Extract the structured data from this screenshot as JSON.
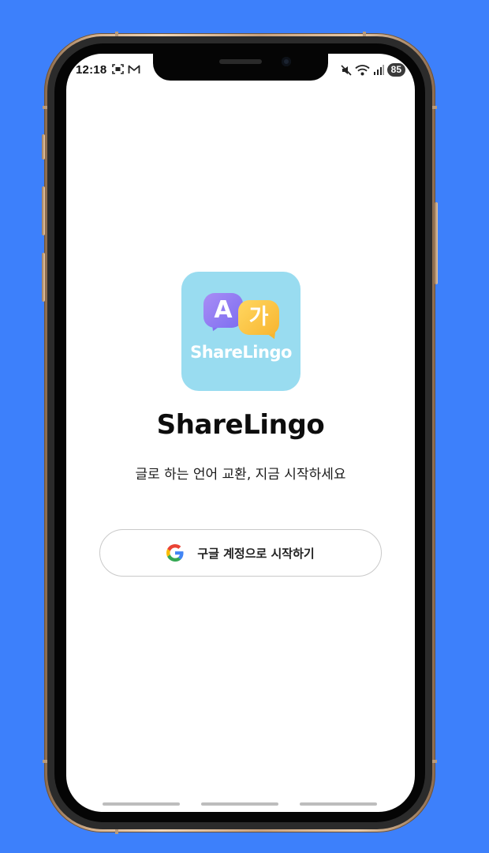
{
  "status_bar": {
    "time": "12:18",
    "battery_level": "85",
    "left_icons": [
      "screenshot-icon",
      "gmail-icon"
    ],
    "right_icons": [
      "mute-icon",
      "wifi-icon",
      "signal-icon"
    ]
  },
  "app": {
    "icon_letter_latin": "A",
    "icon_letter_korean": "가",
    "icon_wordmark": "ShareLingo",
    "name": "ShareLingo",
    "tagline": "글로 하는 언어 교환, 지금 시작하세요"
  },
  "login": {
    "google_button_label": "구글 계정으로 시작하기",
    "google_icon": "google-icon"
  },
  "colors": {
    "background": "#3d80fb",
    "app_icon_bg": "#99dcf0",
    "bubble_purple": "#8270f0",
    "bubble_yellow": "#f8b530"
  }
}
